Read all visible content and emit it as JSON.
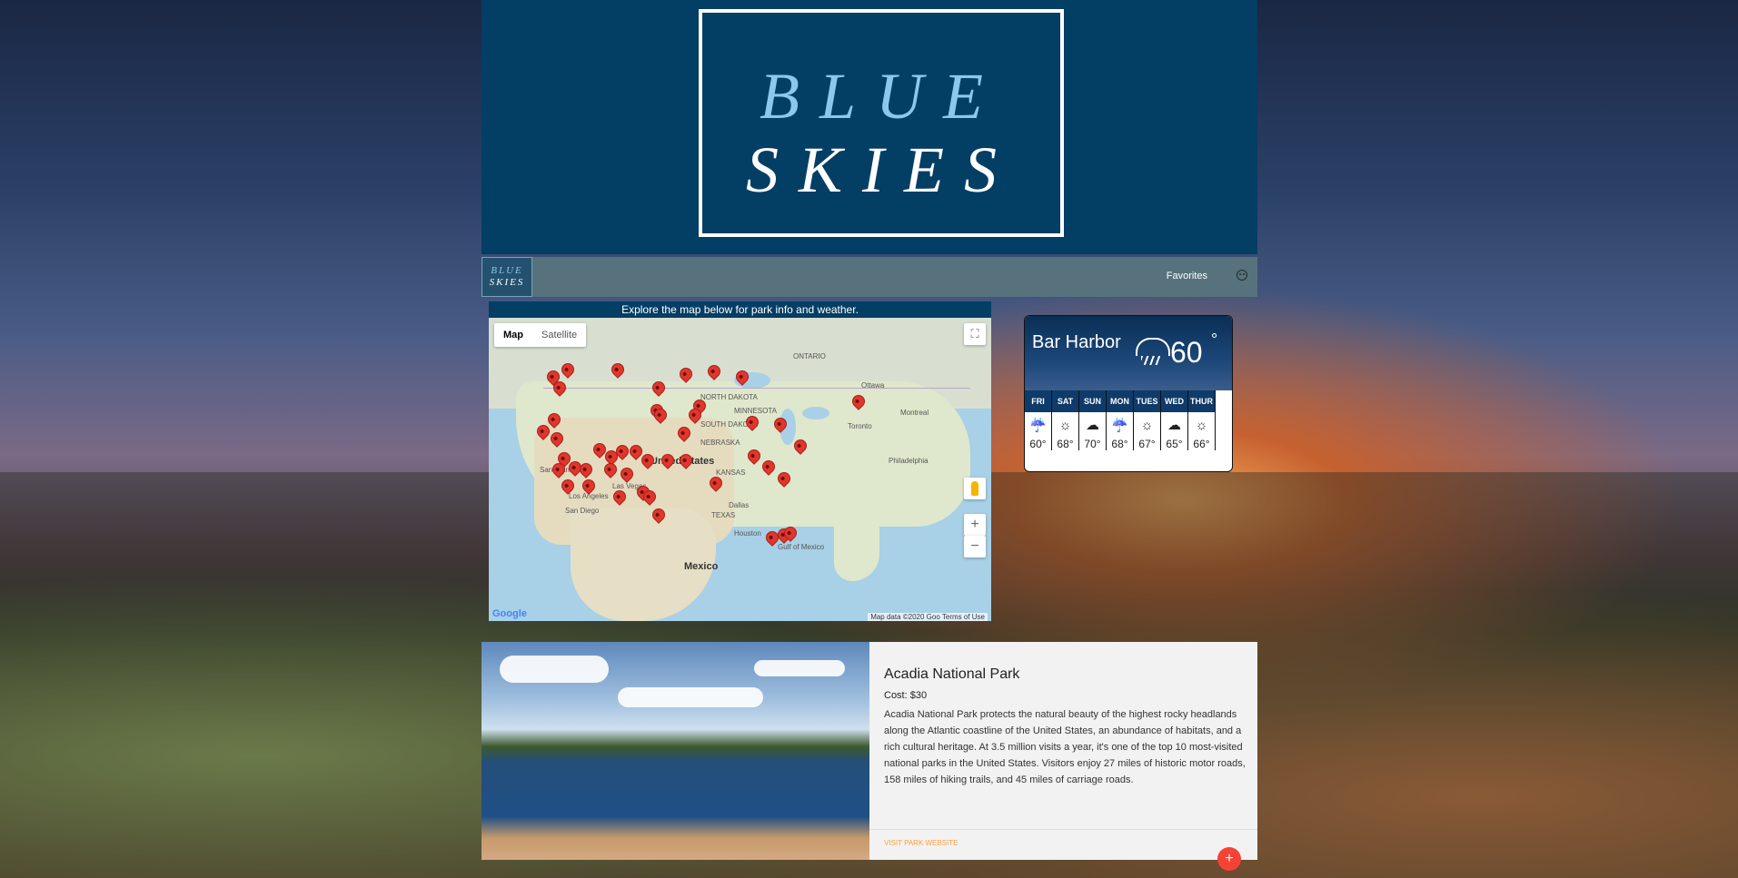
{
  "hero": {
    "line1": "BLUE",
    "line2": "SKIES"
  },
  "navbar": {
    "logo_line1": "BLUE",
    "logo_line2": "SKIES",
    "favorites_label": "Favorites"
  },
  "map": {
    "header": "Explore the map below for park info and weather.",
    "toggle_map": "Map",
    "toggle_satellite": "Satellite",
    "zoom_in": "+",
    "zoom_out": "−",
    "fullscreen": "⛶",
    "google": "Google",
    "map_data": "Map data ©2020 Goo  Terms of Use",
    "labels": {
      "united_states": "United States",
      "mexico": "Mexico",
      "ontario": "ONTARIO",
      "kansas": "KANSAS",
      "nebraska": "NEBRASKA",
      "north_dakota": "NORTH DAKOTA",
      "south_dakota": "SOUTH DAKOTA",
      "minnesota": "MINNESOTA",
      "texas": "TEXAS",
      "dallas": "Dallas",
      "houston": "Houston",
      "san_diego": "San Diego",
      "los_angeles": "Los Angeles",
      "las_vegas": "Las Vegas",
      "san_francisco": "San Fran",
      "montreal": "Montreal",
      "ottawa": "Ottawa",
      "toronto": "Toronto",
      "philadelphia": "Philadelphia",
      "gulf_of_mexico": "Gulf of Mexico"
    }
  },
  "weather": {
    "city": "Bar Harbor",
    "current_temp": "60",
    "degree": "°",
    "days": [
      {
        "name": "FRI",
        "icon": "☔",
        "temp": "60°"
      },
      {
        "name": "SAT",
        "icon": "☼",
        "temp": "68°"
      },
      {
        "name": "SUN",
        "icon": "☁",
        "temp": "70°"
      },
      {
        "name": "MON",
        "icon": "☔",
        "temp": "68°"
      },
      {
        "name": "TUES",
        "icon": "☼",
        "temp": "67°"
      },
      {
        "name": "WED",
        "icon": "☁",
        "temp": "65°"
      },
      {
        "name": "THUR",
        "icon": "☼",
        "temp": "66°"
      }
    ]
  },
  "park": {
    "title": "Acadia National Park",
    "cost": "Cost: $30",
    "description": "Acadia National Park protects the natural beauty of the highest rocky headlands along the Atlantic coastline of the United States, an abundance of habitats, and a rich cultural heritage. At 3.5 million visits a year, it's one of the top 10 most-visited national parks in the United States. Visitors enjoy 27 miles of historic motor roads, 158 miles of hiking trails, and 45 miles of carriage roads.",
    "link": "VISIT PARK WEBSITE",
    "fab": "+"
  },
  "colors": {
    "brand": "#033e65",
    "navbar": "#57727c",
    "accent": "#f44336",
    "link": "#ff9f3c"
  }
}
